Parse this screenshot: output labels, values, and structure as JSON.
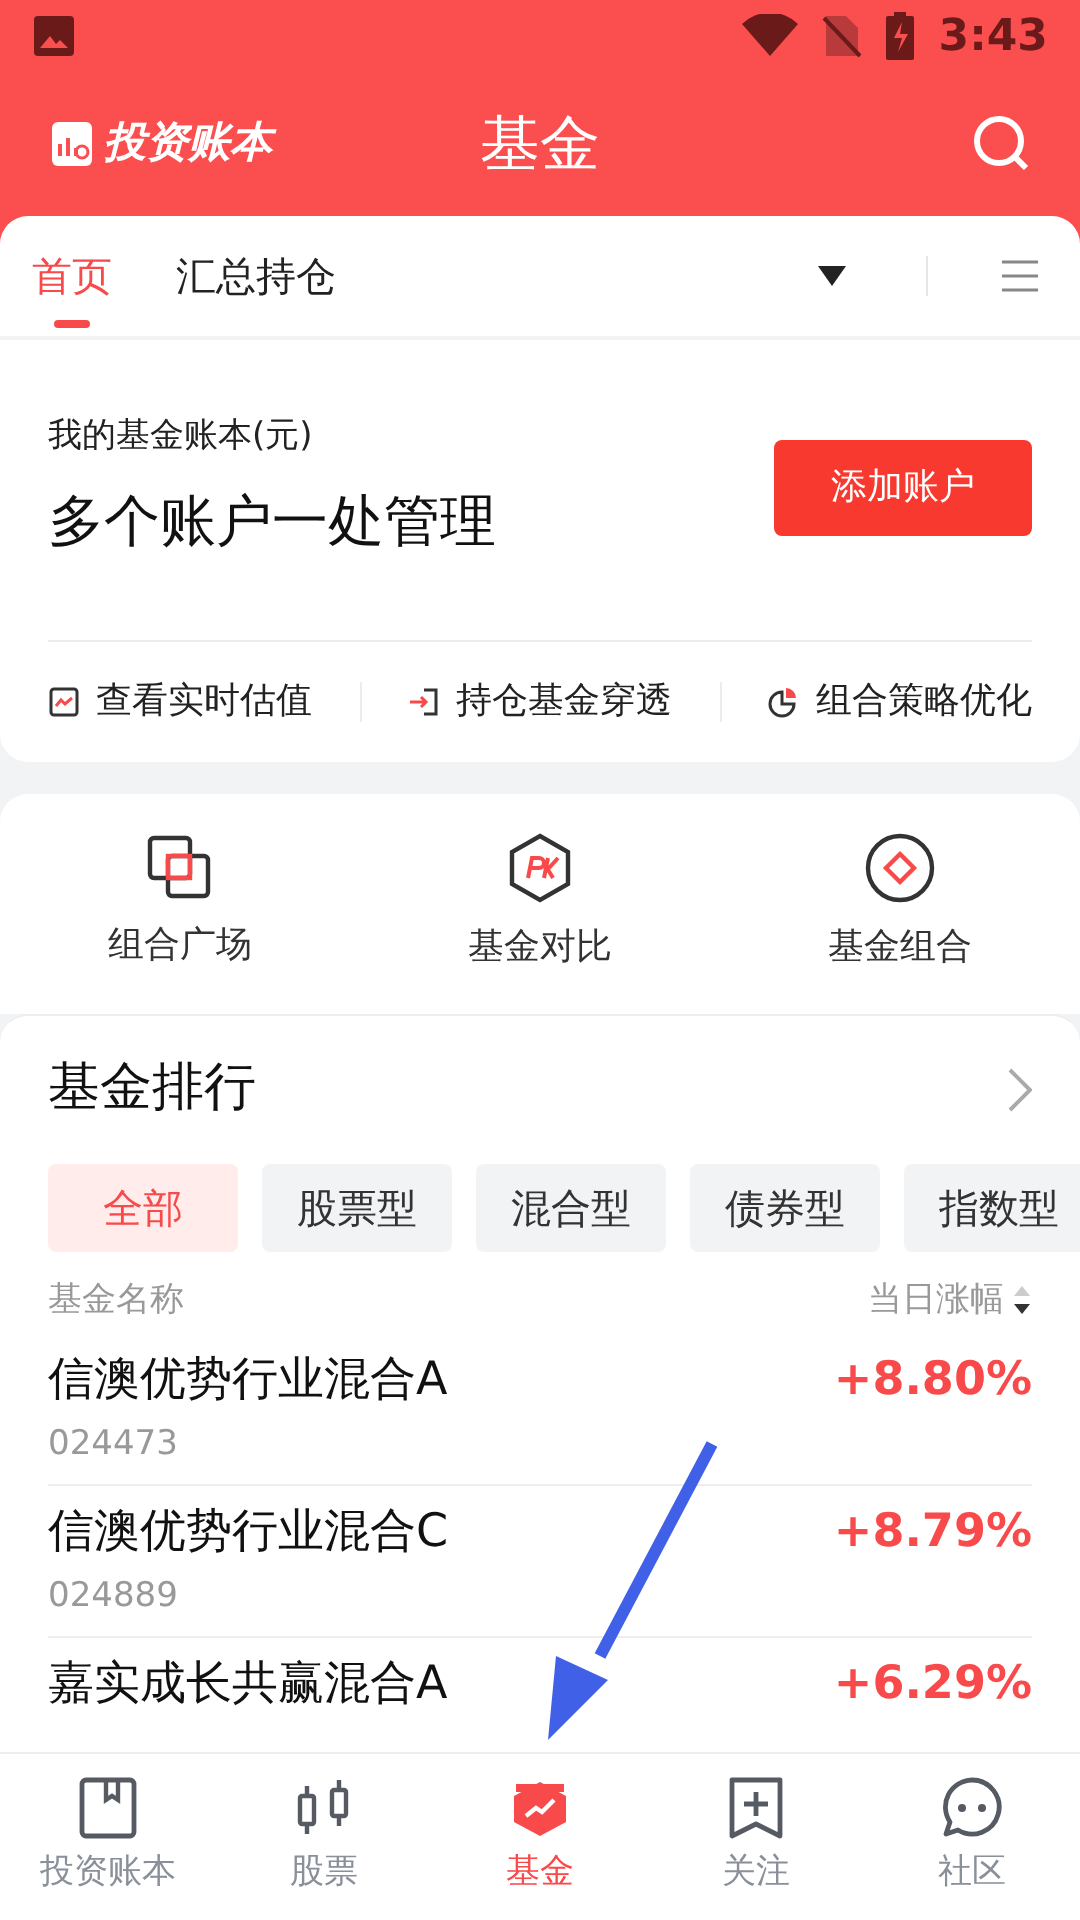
{
  "status_bar": {
    "time": "3:43"
  },
  "header": {
    "logo": "投资账本",
    "title": "基金"
  },
  "tabs": [
    {
      "label": "首页",
      "selected": true
    },
    {
      "label": "汇总持仓",
      "selected": false
    }
  ],
  "account_card": {
    "caption": "我的基金账本(元)",
    "headline": "多个账户一处管理",
    "button": "添加账户",
    "links": [
      {
        "label": "查看实时估值",
        "kind": "chart"
      },
      {
        "label": "持仓基金穿透",
        "kind": "enter"
      },
      {
        "label": "组合策略优化",
        "kind": "pie"
      }
    ]
  },
  "shortcuts": [
    {
      "label": "组合广场",
      "kind": "squares"
    },
    {
      "label": "基金对比",
      "kind": "pk"
    },
    {
      "label": "基金组合",
      "kind": "diamond"
    }
  ],
  "ranking": {
    "title": "基金排行",
    "filters": [
      {
        "label": "全部",
        "selected": true
      },
      {
        "label": "股票型",
        "selected": false
      },
      {
        "label": "混合型",
        "selected": false
      },
      {
        "label": "债券型",
        "selected": false
      },
      {
        "label": "指数型",
        "selected": false
      }
    ],
    "columns": [
      "基金名称",
      "当日涨幅"
    ],
    "rows": [
      {
        "name": "信澳优势行业混合A",
        "code": "024473",
        "change": "+8.80%"
      },
      {
        "name": "信澳优势行业混合C",
        "code": "024889",
        "change": "+8.79%"
      },
      {
        "name": "嘉实成长共赢混合A",
        "change": "+6.29%"
      }
    ]
  },
  "bottom_nav": [
    {
      "label": "投资账本",
      "kind": "book",
      "selected": false
    },
    {
      "label": "股票",
      "kind": "candles",
      "selected": false
    },
    {
      "label": "基金",
      "kind": "fund",
      "selected": true
    },
    {
      "label": "关注",
      "kind": "bookmark",
      "selected": false
    },
    {
      "label": "社区",
      "kind": "chat",
      "selected": false
    }
  ]
}
